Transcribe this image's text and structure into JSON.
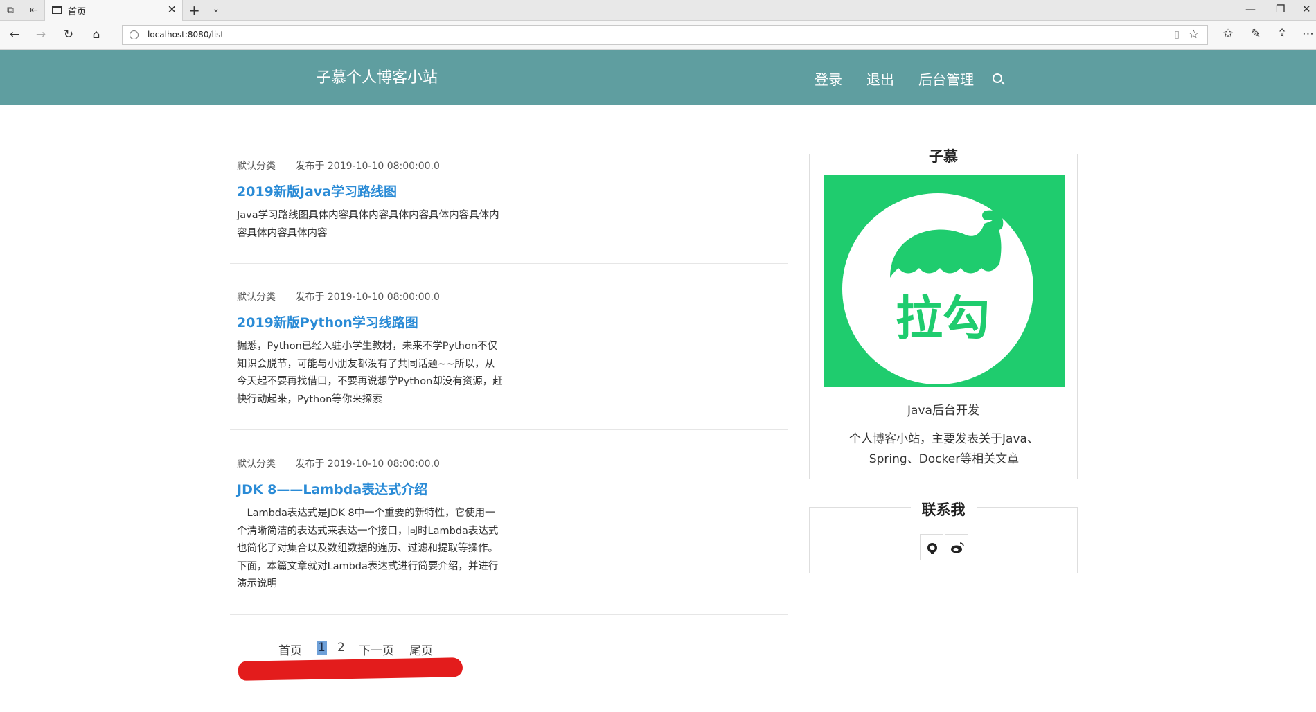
{
  "browser": {
    "tab_title": "首页",
    "url": "localhost:8080/list"
  },
  "site": {
    "title": "子慕个人博客小站",
    "nav": [
      "登录",
      "退出",
      "后台管理"
    ]
  },
  "articles": [
    {
      "category": "默认分类",
      "published": "发布于 2019-10-10 08:00:00.0",
      "title": "2019新版Java学习路线图",
      "summary": "Java学习路线图具体内容具体内容具体内容具体内容具体内容具体内容具体内容"
    },
    {
      "category": "默认分类",
      "published": "发布于 2019-10-10 08:00:00.0",
      "title": "2019新版Python学习线路图",
      "summary": "据悉，Python已经入驻小学生教材，未来不学Python不仅知识会脱节，可能与小朋友都没有了共同话题~~所以，从今天起不要再找借口，不要再说想学Python却没有资源，赶快行动起来，Python等你来探索"
    },
    {
      "category": "默认分类",
      "published": "发布于 2019-10-10 08:00:00.0",
      "title": "JDK 8——Lambda表达式介绍",
      "summary": "　Lambda表达式是JDK 8中一个重要的新特性，它使用一个清晰简洁的表达式来表达一个接口，同时Lambda表达式也简化了对集合以及数组数据的遍历、过滤和提取等操作。下面，本篇文章就对Lambda表达式进行简要介绍，并进行演示说明"
    }
  ],
  "pagination": {
    "first": "首页",
    "pages": [
      "1",
      "2"
    ],
    "current": "1",
    "next": "下一页",
    "last": "尾页"
  },
  "profile": {
    "name": "子慕",
    "logo_text": "拉勾",
    "subtitle": "Java后台开发",
    "description": "个人博客小站，主要发表关于Java、Spring、Docker等相关文章",
    "logo_bg": "#1fcc6e"
  },
  "contact": {
    "title": "联系我",
    "icons": [
      "github-icon",
      "weibo-icon"
    ]
  },
  "colors": {
    "header_bg": "#5f9ea0",
    "title_link": "#2a8bd6",
    "annotation": "#e31c1c"
  }
}
